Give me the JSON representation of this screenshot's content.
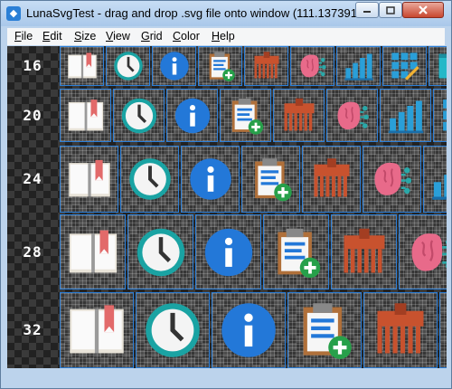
{
  "window": {
    "title": "LunaSvgTest - drag and drop .svg file onto window (111.137391m..."
  },
  "menu": [
    "File",
    "Edit",
    "Size",
    "View",
    "Grid",
    "Color",
    "Help"
  ],
  "rows": [
    {
      "size_label": "16"
    },
    {
      "size_label": "20"
    },
    {
      "size_label": "24"
    },
    {
      "size_label": "28"
    },
    {
      "size_label": "32"
    }
  ],
  "icons": [
    "book-icon",
    "clock-icon",
    "info-icon",
    "clipboard-add-icon",
    "comb-icon",
    "brain-icon",
    "chart-icon",
    "grid-pencil-icon",
    "extra-icon"
  ],
  "colors": {
    "accent": "#2c7fd8",
    "teal": "#1aa3a3",
    "info_blue": "#2378d8",
    "add_green": "#27a04a"
  }
}
